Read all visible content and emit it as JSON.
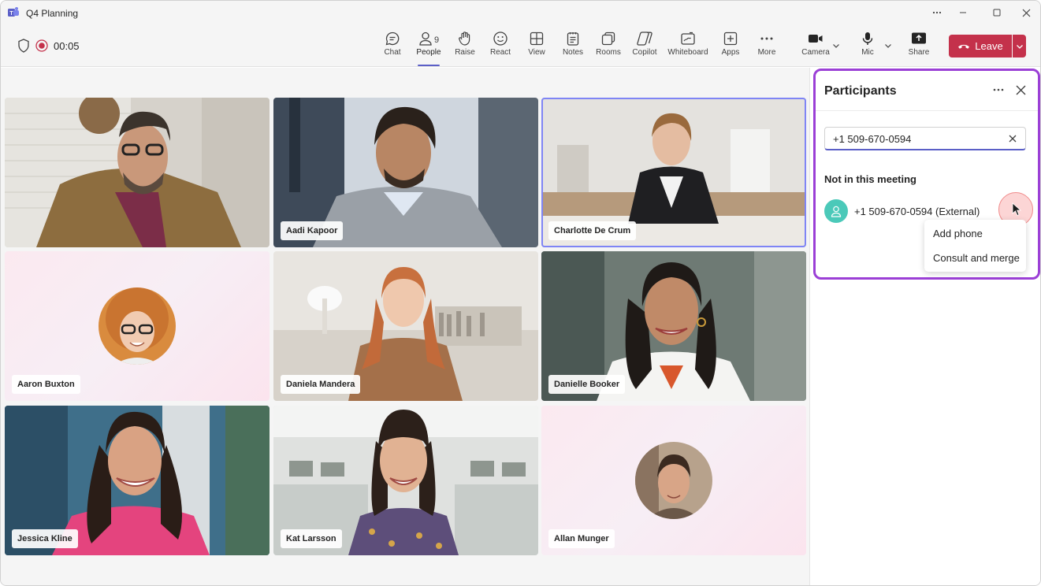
{
  "window": {
    "title": "Q4 Planning"
  },
  "toolbar": {
    "timer": "00:05",
    "buttons": {
      "chat": "Chat",
      "people": "People",
      "people_count": "9",
      "raise": "Raise",
      "react": "React",
      "view": "View",
      "notes": "Notes",
      "rooms": "Rooms",
      "copilot": "Copilot",
      "whiteboard": "Whiteboard",
      "apps": "Apps",
      "more": "More",
      "camera": "Camera",
      "mic": "Mic",
      "share": "Share"
    },
    "leave_label": "Leave",
    "leave_color": "#c4314b",
    "accent_color": "#5b5fc7"
  },
  "participants_grid": [
    {
      "name": "",
      "kind": "video",
      "selected": false
    },
    {
      "name": "Aadi Kapoor",
      "kind": "video",
      "selected": false
    },
    {
      "name": "Charlotte De Crum",
      "kind": "video",
      "selected": true
    },
    {
      "name": "Aaron Buxton",
      "kind": "avatar",
      "selected": false
    },
    {
      "name": "Daniela Mandera",
      "kind": "video",
      "selected": false
    },
    {
      "name": "Danielle Booker",
      "kind": "video",
      "selected": false
    },
    {
      "name": "Jessica Kline",
      "kind": "video",
      "selected": false
    },
    {
      "name": "Kat Larsson",
      "kind": "video",
      "selected": false
    },
    {
      "name": "Allan Munger",
      "kind": "avatar",
      "selected": false
    }
  ],
  "panel": {
    "title": "Participants",
    "search_value": "+1 509-670-0594",
    "section_label": "Not in this meeting",
    "person": "+1 509-670-0594 (External)",
    "menu": [
      "Add phone",
      "Consult and merge"
    ],
    "highlight_color": "#9b3fd6"
  }
}
